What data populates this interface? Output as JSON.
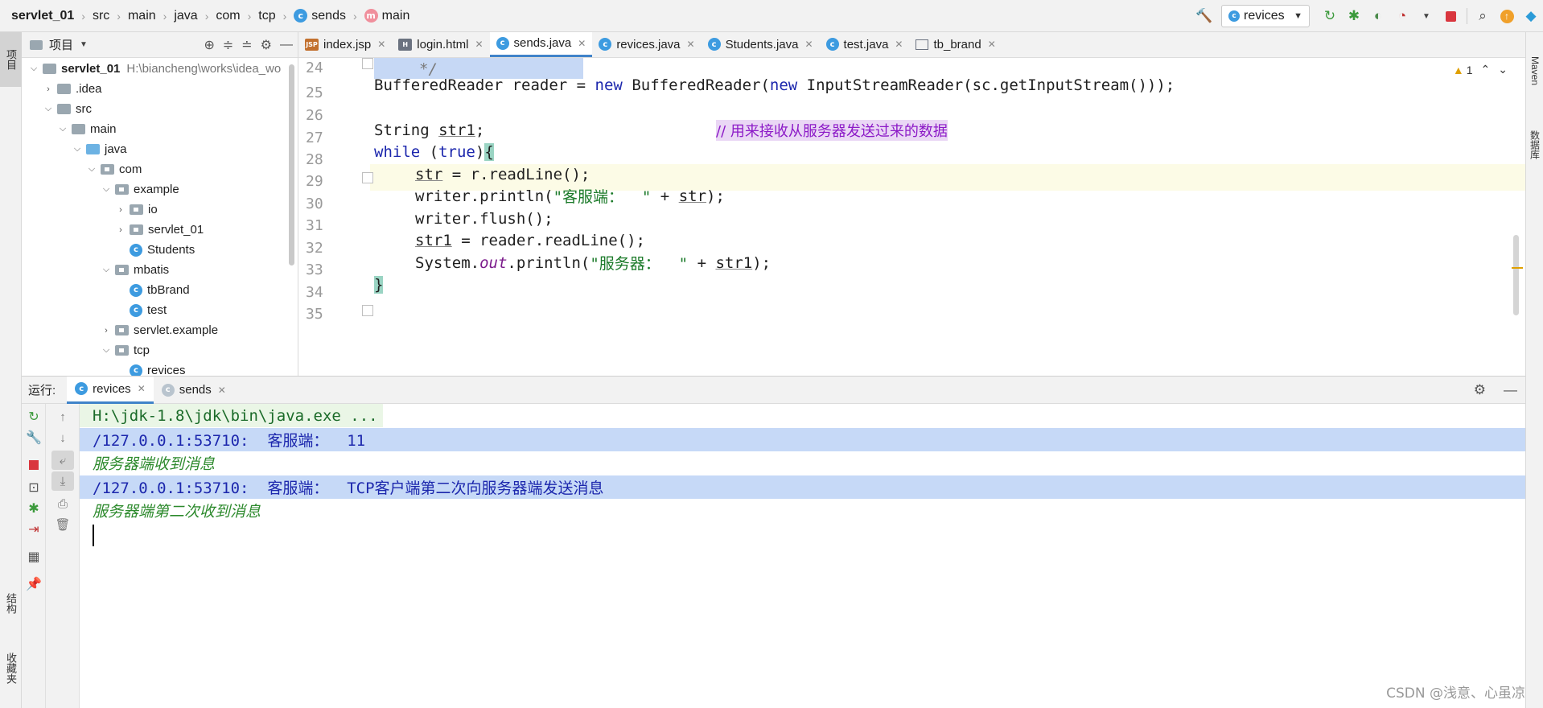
{
  "breadcrumbs": [
    "servlet_01",
    "src",
    "main",
    "java",
    "com",
    "tcp",
    "sends",
    "main"
  ],
  "toolbar": {
    "run_config": "revices",
    "icons": [
      "hammer-icon",
      "rerun-icon",
      "debug-icon",
      "coverage-icon",
      "profile-icon",
      "stop-icon",
      "search-icon",
      "update-icon",
      "plugin-icon"
    ]
  },
  "left_strip": {
    "project": "项目",
    "structure": "结构",
    "favorites": "收藏夹"
  },
  "right_strip": {
    "maven": "Maven",
    "database": "数据库"
  },
  "project_panel": {
    "title": "项目",
    "root_label": "servlet_01",
    "root_path": "H:\\biancheng\\works\\idea_wo",
    "tree": [
      {
        "label": ".idea"
      },
      {
        "label": "src"
      },
      {
        "label": "main"
      },
      {
        "label": "java"
      },
      {
        "label": "com"
      },
      {
        "label": "example"
      },
      {
        "label": "io"
      },
      {
        "label": "servlet_01"
      },
      {
        "label": "Students"
      },
      {
        "label": "mbatis"
      },
      {
        "label": "tbBrand"
      },
      {
        "label": "test"
      },
      {
        "label": "servlet.example"
      },
      {
        "label": "tcp"
      },
      {
        "label": "revices"
      }
    ]
  },
  "editor": {
    "tabs": [
      "index.jsp",
      "login.html",
      "sends.java",
      "revices.java",
      "Students.java",
      "test.java",
      "tb_brand"
    ],
    "active_tab": "sends.java",
    "warnings": "1",
    "line_numbers": [
      "24",
      "25",
      "26",
      "27",
      "28",
      "29",
      "30",
      "31",
      "32",
      "33",
      "34",
      "35"
    ],
    "code": {
      "l24": "*/",
      "l25_a": "BufferedReader reader = ",
      "l25_new1": "new",
      "l25_b": " BufferedReader(",
      "l25_new2": "new",
      "l25_c": " InputStreamReader(sc.getInputStream()));",
      "l27_a": "String ",
      "l27_var": "str1",
      "l27_b": ";",
      "l27_comment": "// 用来接收从服务器发送过来的数据",
      "l28_kw": "while",
      "l28_b": " (",
      "l28_true": "true",
      "l28_c": ")",
      "l28_brace": "{",
      "l29_var": "str",
      "l29_b": " = r.readLine();",
      "l30_a": "writer.println(",
      "l30_str": "\"客服端：  \"",
      "l30_b": " + ",
      "l30_var": "str",
      "l30_c": ");",
      "l31": "writer.flush();",
      "l32_var": "str1",
      "l32_b": " = reader.readLine();",
      "l33_a": "System.",
      "l33_out": "out",
      "l33_b": ".println(",
      "l33_str": "\"服务器：  \"",
      "l33_c": " + ",
      "l33_var": "str1",
      "l33_d": ");",
      "l34_brace": "}"
    }
  },
  "run_panel": {
    "label": "运行:",
    "tabs": [
      "revices",
      "sends"
    ],
    "active_tab": "revices",
    "console": [
      "H:\\jdk-1.8\\jdk\\bin\\java.exe ...",
      "/127.0.0.1:53710:  客服端：  11",
      "服务器端收到消息",
      "/127.0.0.1:53710:  客服端：  TCP客户端第二次向服务器端发送消息",
      "服务器端第二次收到消息"
    ]
  },
  "watermark": "CSDN @浅意、心虽凉",
  "colors": {
    "accent": "#4083c9",
    "keyword": "#1c27ad",
    "string": "#1b7a29",
    "comment": "#8c1ac7",
    "info": "#2d8a2d"
  }
}
